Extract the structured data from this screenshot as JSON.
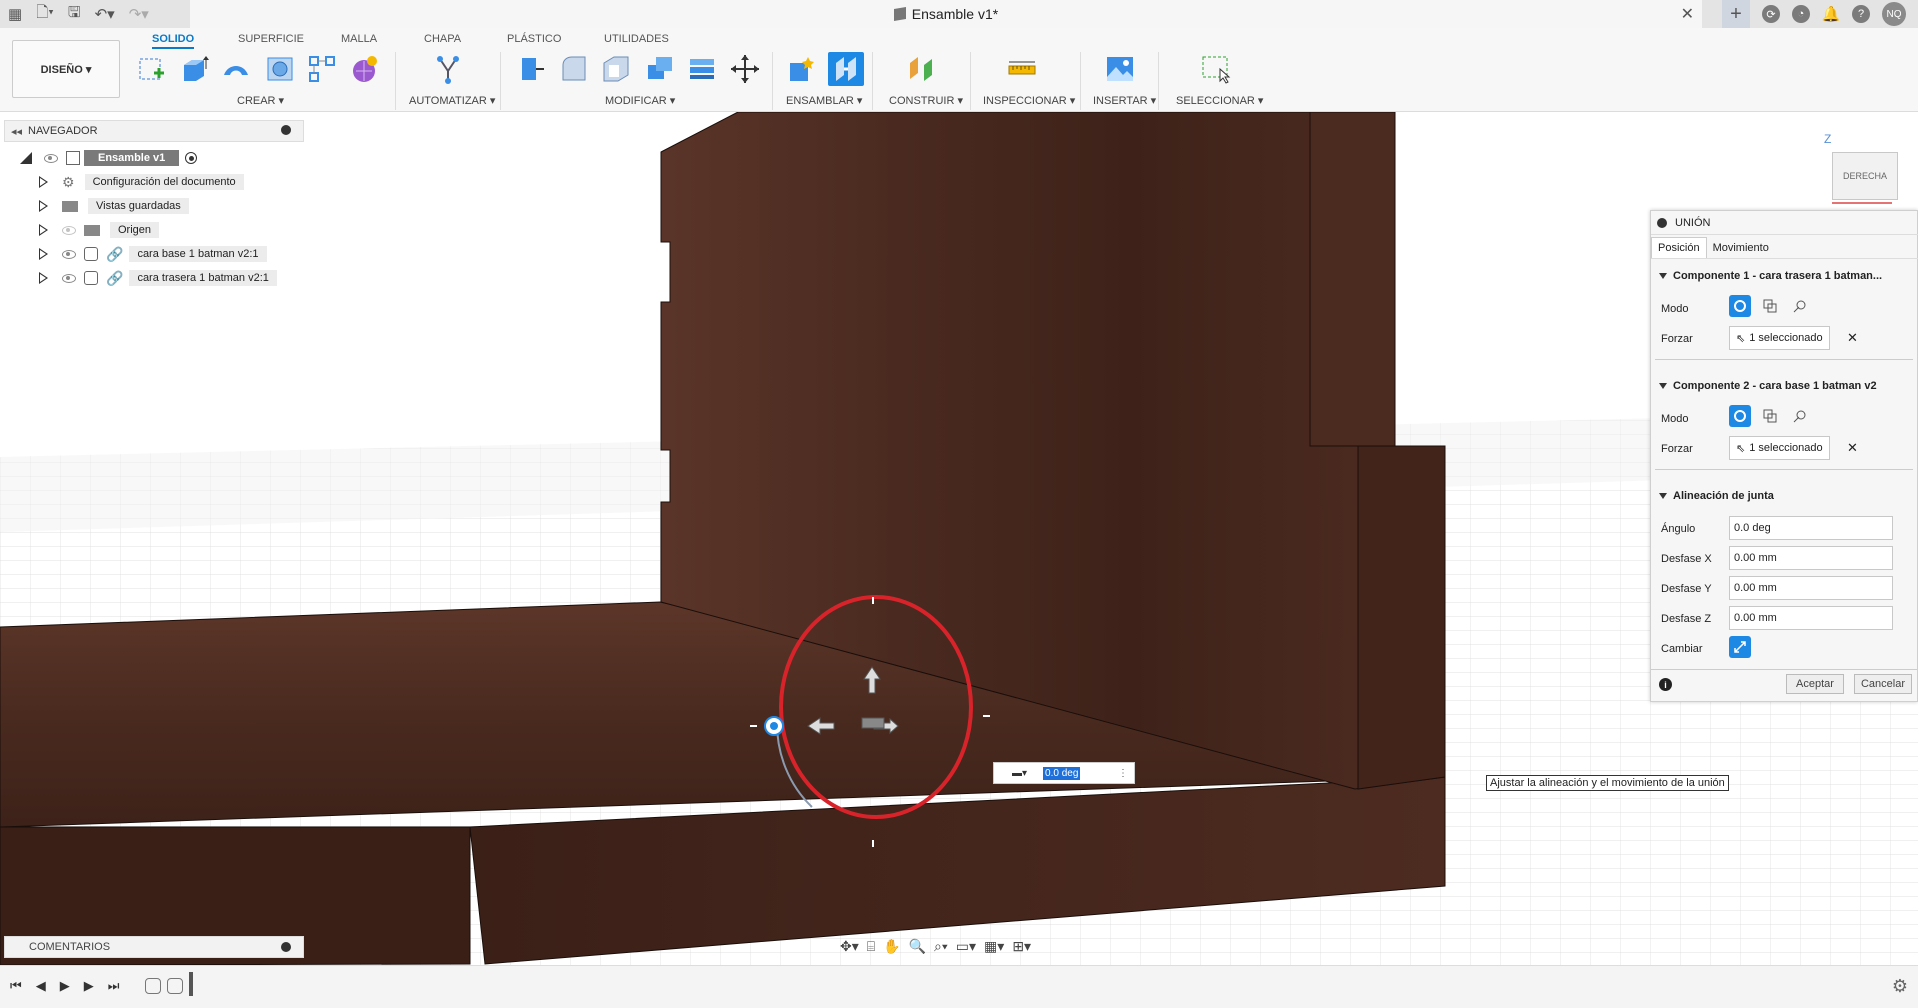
{
  "document": {
    "title": "Ensamble v1*",
    "user_initials": "NQ"
  },
  "toolbar": {
    "workspace_button": "DISEÑO ▾",
    "tabs": [
      {
        "label": "SOLIDO",
        "active": true
      },
      {
        "label": "SUPERFICIE"
      },
      {
        "label": "MALLA"
      },
      {
        "label": "CHAPA"
      },
      {
        "label": "PLÁSTICO"
      },
      {
        "label": "UTILIDADES"
      }
    ],
    "groups": [
      "CREAR ▾",
      "AUTOMATIZAR ▾",
      "MODIFICAR ▾",
      "ENSAMBLAR ▾",
      "CONSTRUIR ▾",
      "INSPECCIONAR ▾",
      "INSERTAR ▾",
      "SELECCIONAR ▾"
    ]
  },
  "navigator": {
    "title": "NAVEGADOR",
    "root": "Ensamble v1",
    "items": [
      "Configuración del documento",
      "Vistas guardadas",
      "Origen",
      "cara base 1 batman v2:1",
      "cara trasera 1 batman v2:1"
    ]
  },
  "comments": {
    "title": "COMENTARIOS"
  },
  "viewcube": {
    "axis": "Z",
    "face": "DERECHA"
  },
  "union": {
    "title": "UNIÓN",
    "tabs": [
      "Posición",
      "Movimiento"
    ],
    "comp1": {
      "header": "Componente 1 - cara trasera 1 batman...",
      "mode_label": "Modo",
      "force_label": "Forzar",
      "selection": "1 seleccionado"
    },
    "comp2": {
      "header": "Componente 2 - cara base 1 batman v2",
      "mode_label": "Modo",
      "force_label": "Forzar",
      "selection": "1 seleccionado"
    },
    "alignment": {
      "header": "Alineación de junta",
      "angle_label": "Ángulo",
      "angle": "0.0 deg",
      "offx_label": "Desfase X",
      "offx": "0.00 mm",
      "offy_label": "Desfase Y",
      "offy": "0.00 mm",
      "offz_label": "Desfase Z",
      "offz": "0.00 mm",
      "flip_label": "Cambiar"
    },
    "ok": "Aceptar",
    "cancel": "Cancelar"
  },
  "manipulator": {
    "angle_value": "0.0 deg"
  },
  "tooltip": "Ajustar la alineación y el movimiento de la unión",
  "colors": {
    "accent": "#0a7ac8",
    "wood": "#4a2a20",
    "highlight_circle": "#d9232a"
  }
}
